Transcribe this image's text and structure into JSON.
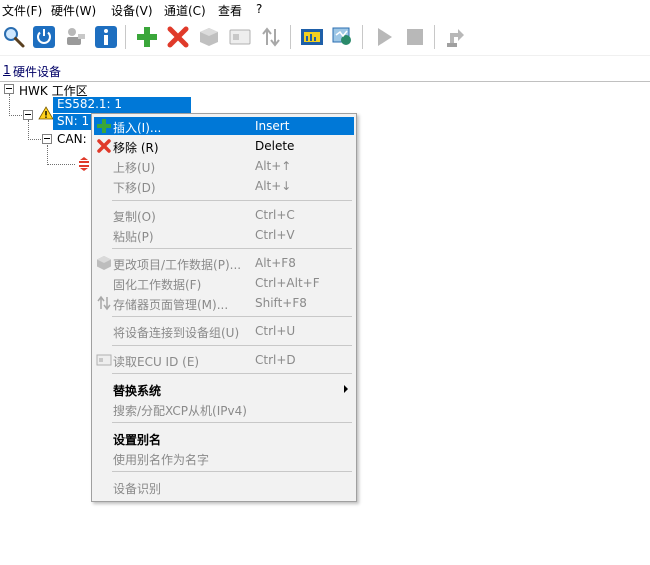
{
  "menubar": {
    "items": [
      "文件(F)",
      "硬件(W)",
      "设备(V)",
      "通道(C)",
      "查看",
      "?"
    ]
  },
  "toolbar": {
    "buttons": [
      "search-icon",
      "power-icon",
      "network-icon",
      "info-icon",
      "add-icon",
      "delete-icon",
      "module-icon",
      "id-card-icon",
      "up-down-icon",
      "device-chart-icon",
      "device-scan-icon",
      "play-icon",
      "stop-icon",
      "settings-device-icon"
    ]
  },
  "tab": {
    "number": "1",
    "label": "硬件设备"
  },
  "tree": {
    "root": "HWK 工作区",
    "device": "ES582.1: 1",
    "sn": "SN: 1",
    "can": "CAN:"
  },
  "context_menu": {
    "items": [
      {
        "label": "插入(I)...",
        "shortcut": "Insert",
        "enabled": true,
        "highlighted": true,
        "icon": "plus-icon"
      },
      {
        "label": "移除 (R)",
        "shortcut": "Delete",
        "enabled": true,
        "icon": "x-icon"
      },
      {
        "label": "上移(U)",
        "shortcut": "Alt+↑",
        "enabled": false
      },
      {
        "label": "下移(D)",
        "shortcut": "Alt+↓",
        "enabled": false
      },
      {
        "label": "复制(O)",
        "shortcut": "Ctrl+C",
        "enabled": false
      },
      {
        "label": "粘贴(P)",
        "shortcut": "Ctrl+V",
        "enabled": false
      },
      {
        "label": "更改项目/工作数据(P)...",
        "shortcut": "Alt+F8",
        "enabled": false,
        "icon": "cube-icon"
      },
      {
        "label": "固化工作数据(F)",
        "shortcut": "Ctrl+Alt+F",
        "enabled": false
      },
      {
        "label": "存储器页面管理(M)...",
        "shortcut": "Shift+F8",
        "enabled": false,
        "icon": "up-down-icon"
      },
      {
        "label": "将设备连接到设备组(U)",
        "shortcut": "Ctrl+U",
        "enabled": false
      },
      {
        "label": "读取ECU ID (E)",
        "shortcut": "Ctrl+D",
        "enabled": false,
        "icon": "id-icon"
      },
      {
        "label": "替换系统",
        "shortcut": "",
        "enabled": true,
        "bold": true,
        "submenu": true
      },
      {
        "label": "搜索/分配XCP从机(IPv4)",
        "shortcut": "",
        "enabled": false
      },
      {
        "label": "设置别名",
        "shortcut": "",
        "enabled": true,
        "bold": true
      },
      {
        "label": "使用别名作为名字",
        "shortcut": "",
        "enabled": false
      },
      {
        "label": "设备识别",
        "shortcut": "",
        "enabled": false
      }
    ]
  },
  "colors": {
    "selection": "#0078d7",
    "disabled_text": "#8a8a8a",
    "menu_bg": "#f2f2f2"
  }
}
